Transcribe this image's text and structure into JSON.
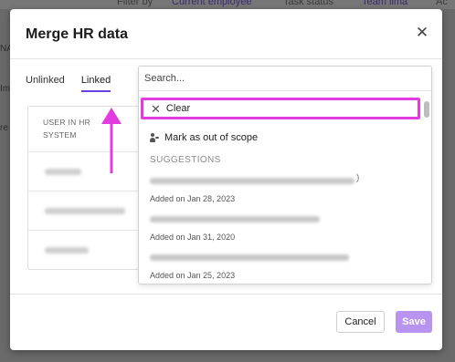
{
  "background": {
    "topbar": [
      "Filter by",
      "Current employee",
      "Task status",
      "Team lima",
      "Ac"
    ],
    "side_fragments": [
      "NA",
      "Im",
      "re"
    ]
  },
  "modal": {
    "title": "Merge HR data",
    "close_icon": "close-icon",
    "tabs": [
      {
        "label": "Unlinked",
        "active": false
      },
      {
        "label": "Linked",
        "active": true
      }
    ],
    "table": {
      "header": "USER IN HR SYSTEM",
      "rows_count_visible": 3
    },
    "dropdown": {
      "search_placeholder": "Search...",
      "clear_label": "Clear",
      "out_of_scope_label": "Mark as out of scope",
      "suggestions_heading": "SUGGESTIONS",
      "suggestions": [
        {
          "date": "Added on Jan 28, 2023"
        },
        {
          "date": "Added on Jan 31, 2020"
        },
        {
          "date": "Added on Jan 25, 2023"
        }
      ]
    },
    "footer": {
      "cancel_label": "Cancel",
      "save_label": "Save"
    }
  },
  "colors": {
    "highlight": "#e23be0",
    "accent": "#6a3fe0",
    "save_disabled": "#b993f0"
  }
}
